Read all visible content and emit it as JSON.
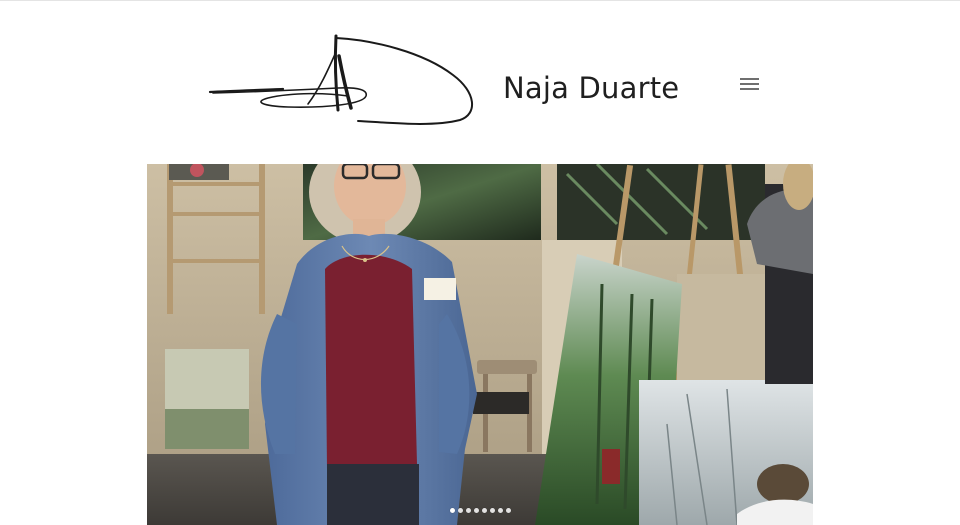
{
  "header": {
    "logo": "signature-logo",
    "title": "Naja Duarte",
    "menu_icon": "hamburger-menu-icon"
  },
  "slideshow": {
    "image": "artist-portrait-exhibition",
    "slide_count": 8,
    "active_slide": 1
  },
  "colors": {
    "background": "#ffffff",
    "title_text": "#1f1f1f",
    "menu_icon": "#6f6f6f"
  }
}
